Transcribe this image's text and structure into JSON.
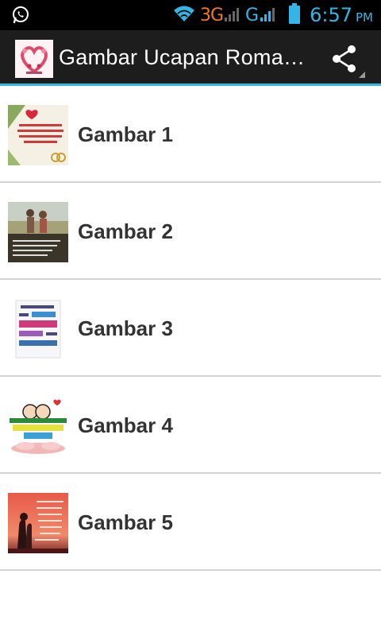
{
  "status_bar": {
    "left_icon": "whatsapp-icon",
    "network_3g": "3G",
    "network_g": "G",
    "time": "6:57",
    "ampm": "PM",
    "accent_color": "#33b5e5",
    "network_color": "#f07a1a"
  },
  "action_bar": {
    "title": "Gambar Ucapan Romantis",
    "icon": "heart-wreath-icon",
    "share_icon": "share-icon",
    "accent_color": "#33b5e5"
  },
  "list": {
    "items": [
      {
        "label": "Gambar 1",
        "thumb": "love-quote-thumbnail"
      },
      {
        "label": "Gambar 2",
        "thumb": "couple-photo-thumbnail"
      },
      {
        "label": "Gambar 3",
        "thumb": "typography-thumbnail"
      },
      {
        "label": "Gambar 4",
        "thumb": "cartoon-couple-thumbnail"
      },
      {
        "label": "Gambar 5",
        "thumb": "sunset-silhouette-thumbnail"
      }
    ]
  }
}
